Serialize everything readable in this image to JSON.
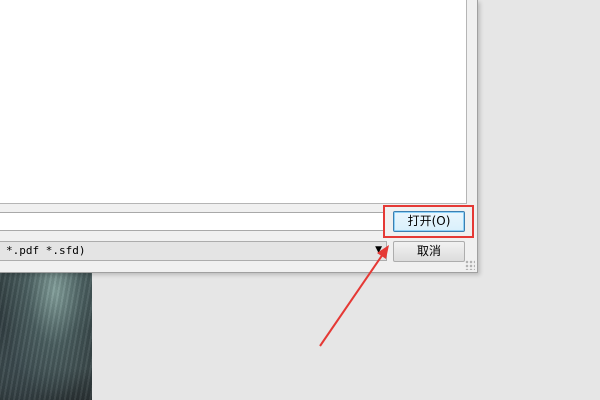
{
  "dialog": {
    "filename_value": "",
    "filetype_value": "*.pdf *.sfd)",
    "open_button_label": "打开(O)",
    "cancel_button_label": "取消"
  },
  "annotation": {
    "highlight_color": "#e53935",
    "arrow_color": "#e53935"
  }
}
